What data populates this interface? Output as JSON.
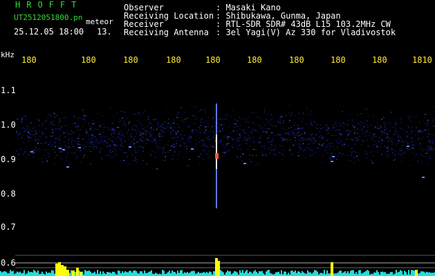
{
  "header": {
    "app_title": "HROFFT",
    "filename": "UT2512051800.pn",
    "meteor_label": "meteor",
    "datetime": "25.12.05 18:00",
    "count": "13.",
    "fields": [
      {
        "label": "Observer",
        "value": ": Masaki Kano"
      },
      {
        "label": "Receiving Location",
        "value": ": Shibukawa, Gunma, Japan"
      },
      {
        "label": "Receiver",
        "value": ": RTL-SDR SDR# 43dB L15 103.2MHz CW"
      },
      {
        "label": "Receiving Antenna",
        "value": ": 3el Yagi(V) Az 330 for Vladivostok"
      }
    ]
  },
  "axis": {
    "y_unit": "kHz",
    "time_ticks": [
      "180",
      "180",
      "180",
      "180",
      "180",
      "180",
      "180",
      "180",
      "180",
      "1810"
    ],
    "freq_ticks": [
      "1.1",
      "1.0",
      "0.9",
      "0.8",
      "0.7",
      "0.6"
    ]
  },
  "colors": {
    "header_green": "#33dd33",
    "label_yellow": "#ffee33",
    "background": "#000000",
    "signal_blue": "#2233aa",
    "meteor_white": "#ffffff",
    "power_cyan": "#22dddd",
    "power_yellow": "#ffff00"
  }
}
